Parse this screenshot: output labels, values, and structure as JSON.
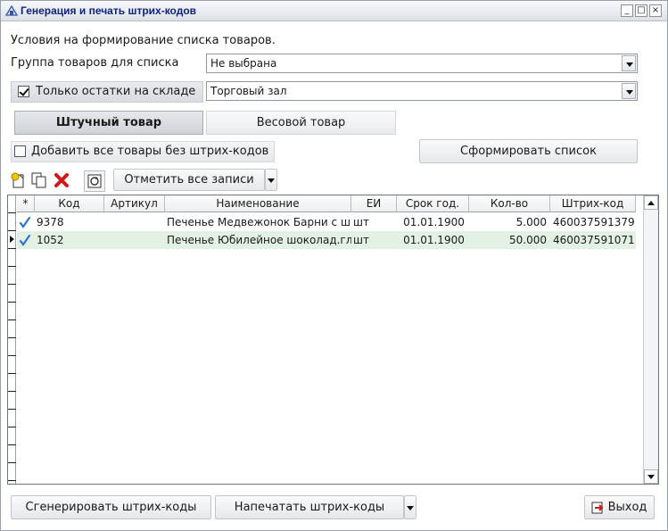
{
  "window": {
    "title": "Генерация и печать штрих-кодов",
    "controls": {
      "minimize": "_",
      "maximize": "□",
      "close": "×"
    }
  },
  "conditions": {
    "heading": "Условия на формирование списка товаров.",
    "group_label": "Группа товаров для списка",
    "group_value": "Не выбрана",
    "stock_only_label": "Только остатки на складе",
    "stock_only_checked": true,
    "warehouse_value": "Торговый зал"
  },
  "tabs": [
    {
      "label": "Штучный товар",
      "active": true
    },
    {
      "label": "Весовой товар",
      "active": false
    }
  ],
  "options": {
    "add_without_barcodes_label": "Добавить все товары без штрих-кодов",
    "add_without_barcodes_checked": false,
    "build_list_button": "Сформировать список"
  },
  "toolbar": {
    "mark_all_button": "Отметить все записи"
  },
  "table": {
    "columns": [
      "*",
      "Код",
      "Артикул",
      "Наименование",
      "ЕИ",
      "Срок год.",
      "Кол-во",
      "Штрих-код"
    ],
    "rows": [
      {
        "code": "9378",
        "article": "",
        "name": "Печенье  Медвежонок Барни с ш",
        "unit": "шт",
        "expiry": "01.01.1900",
        "qty": "5.000",
        "barcode": "460037591379"
      },
      {
        "code": "1052",
        "article": "",
        "name": "Печенье Юбилейное шоколад.гл",
        "unit": "шт",
        "expiry": "01.01.1900",
        "qty": "50.000",
        "barcode": "460037591071"
      }
    ]
  },
  "footer": {
    "generate_button": "Сгенерировать штрих-коды",
    "print_button": "Напечатать штрих-коды",
    "exit_button": "Выход"
  },
  "colors": {
    "title_text": "#10247a",
    "selected_row": "#e2f1e4",
    "check_mark": "#2f74c9",
    "delete_icon": "#d01818"
  }
}
